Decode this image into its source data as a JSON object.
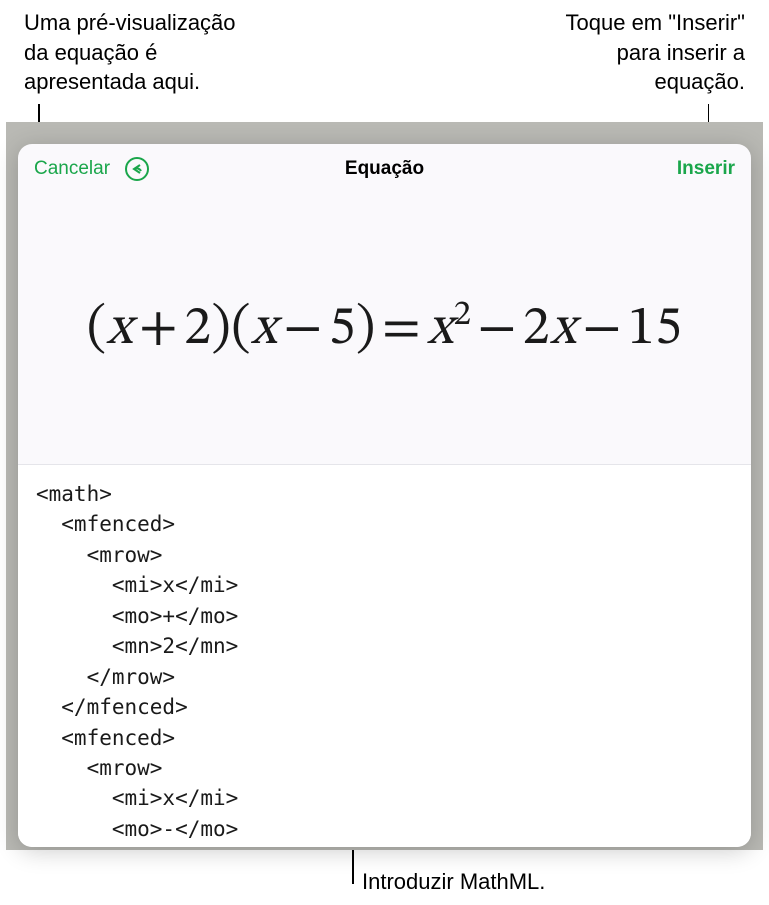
{
  "callouts": {
    "top_left": "Uma pré-visualização da equação é apresentada aqui.",
    "top_right": "Toque em \"Inserir\" para inserir a equação.",
    "bottom": "Introduzir MathML."
  },
  "toolbar": {
    "cancel_label": "Cancelar",
    "insert_label": "Inserir",
    "title": "Equação"
  },
  "preview": {
    "equation_text": "(x + 2)(x − 5) = x² − 2x − 15"
  },
  "editor": {
    "content": "<math>\n  <mfenced>\n    <mrow>\n      <mi>x</mi>\n      <mo>+</mo>\n      <mn>2</mn>\n    </mrow>\n  </mfenced>\n  <mfenced>\n    <mrow>\n      <mi>x</mi>\n      <mo>-</mo>"
  }
}
